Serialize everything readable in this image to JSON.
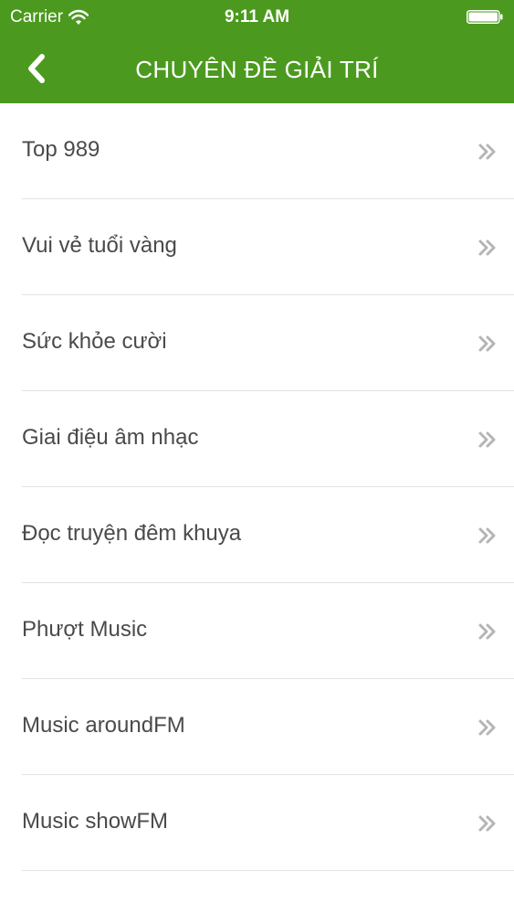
{
  "status_bar": {
    "carrier": "Carrier",
    "time": "9:11 AM",
    "icons": [
      "wifi-icon",
      "battery-icon"
    ]
  },
  "nav": {
    "back_icon": "chevron-left-icon",
    "title": "CHUYÊN ĐỀ GIẢI TRÍ"
  },
  "list": {
    "items": [
      {
        "label": "Top 989"
      },
      {
        "label": "Vui vẻ tuổi vàng"
      },
      {
        "label": "Sức khỏe cười"
      },
      {
        "label": "Giai điệu âm nhạc"
      },
      {
        "label": "Đọc truyện đêm khuya"
      },
      {
        "label": "Phượt Music"
      },
      {
        "label": "Music aroundFM"
      },
      {
        "label": "Music showFM"
      }
    ],
    "row_icon": "double-chevron-right-icon"
  },
  "colors": {
    "header_bg": "#4b9a1f",
    "header_text": "#ffffff",
    "item_text": "#4a4a4a",
    "divider": "#e3e3e3",
    "chevron": "#b5b5b5"
  }
}
